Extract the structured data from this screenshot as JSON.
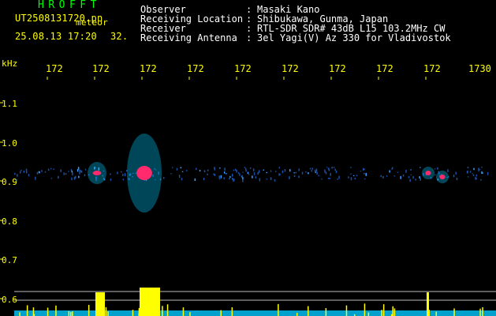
{
  "header": {
    "app_title": "HROFFT",
    "file_name": "UT2508131720.pn",
    "file_tag": "meteor",
    "timestamp": "25.08.13 17:20",
    "count": "32."
  },
  "meta": [
    {
      "key": "Observer",
      "sep": ":",
      "value": "Masaki Kano"
    },
    {
      "key": "Receiving Location",
      "sep": ":",
      "value": "Shibukawa, Gunma, Japan"
    },
    {
      "key": "Receiver",
      "sep": ":",
      "value": "RTL-SDR SDR# 43dB L15 103.2MHz CW"
    },
    {
      "key": "Receiving Antenna",
      "sep": ":",
      "value": "3el Yagi(V) Az 330 for Vladivostok"
    }
  ],
  "colors": {
    "label": "#ffff00",
    "title": "#00ff00",
    "signal": "#ff2a6d",
    "echo": "#00c8ff",
    "background": "#000000"
  },
  "chart_data": {
    "type": "heatmap",
    "title": "",
    "xlabel": "",
    "ylabel": "kHz",
    "x_tick_labels": [
      "172",
      "172",
      "172",
      "172",
      "172",
      "172",
      "172",
      "172",
      "172",
      "1730"
    ],
    "y_tick_labels": [
      "1.1",
      "1.0",
      "0.9",
      "0.8",
      "0.7",
      "0.6"
    ],
    "ylim": [
      0.58,
      1.13
    ],
    "meteor_echoes": [
      {
        "time_index": 2.0,
        "freq_khz": 0.92,
        "strength": "medium"
      },
      {
        "time_index": 3.0,
        "freq_khz": 0.92,
        "strength": "strong"
      },
      {
        "time_index": 9.0,
        "freq_khz": 0.92,
        "strength": "weak"
      },
      {
        "time_index": 9.3,
        "freq_khz": 0.91,
        "strength": "weak"
      }
    ]
  }
}
